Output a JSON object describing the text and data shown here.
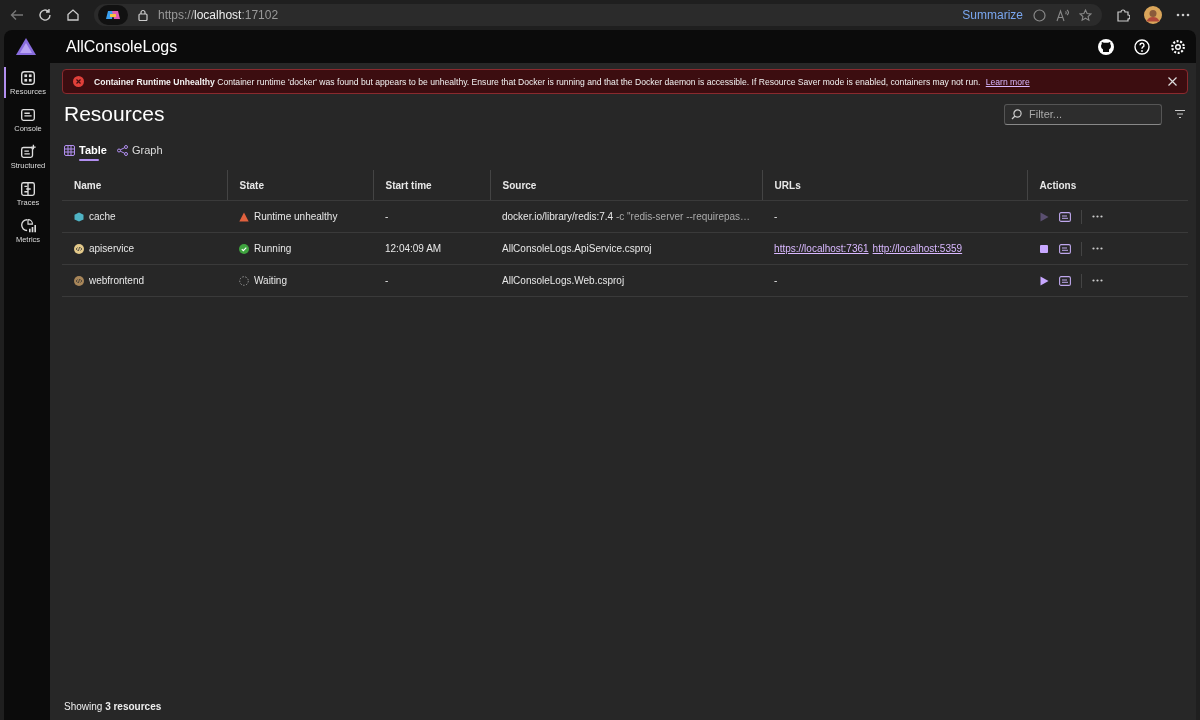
{
  "browser": {
    "url_scheme": "https://",
    "url_host": "localhost",
    "url_port": ":17102",
    "summarize": "Summarize"
  },
  "header": {
    "title": "AllConsoleLogs"
  },
  "sidebar": {
    "items": [
      {
        "label": "Resources",
        "kind": "resources",
        "selected": true
      },
      {
        "label": "Console",
        "kind": "console",
        "selected": false
      },
      {
        "label": "Structured",
        "kind": "structured",
        "selected": false
      },
      {
        "label": "Traces",
        "kind": "traces",
        "selected": false
      },
      {
        "label": "Metrics",
        "kind": "metrics",
        "selected": false
      }
    ]
  },
  "alert": {
    "title": "Container Runtime Unhealthy",
    "message": "Container runtime 'docker' was found but appears to be unhealthy. Ensure that Docker is running and that the Docker daemon is accessible. If Resource Saver mode is enabled, containers may not run.",
    "link": "Learn more"
  },
  "page_title": "Resources",
  "filter": {
    "placeholder": "Filter..."
  },
  "view_tabs": [
    {
      "label": "Table",
      "kind": "table",
      "selected": true
    },
    {
      "label": "Graph",
      "kind": "graph",
      "selected": false
    }
  ],
  "table": {
    "columns": [
      "Name",
      "State",
      "Start time",
      "Source",
      "URLs",
      "Actions"
    ],
    "rows": [
      {
        "name": "cache",
        "kind": "container",
        "color": "#4fb3c4",
        "state": {
          "text": "Runtime unhealthy",
          "kind": "warning"
        },
        "start_time": "-",
        "source": "docker.io/library/redis:7.4",
        "source_args": "-c \"redis-server --requirepas…",
        "urls": [],
        "urls_empty": "-",
        "action": {
          "kind": "start",
          "disabled": true
        }
      },
      {
        "name": "apiservice",
        "kind": "project",
        "color": "#e3c98a",
        "state": {
          "text": "Running",
          "kind": "running"
        },
        "start_time": "12:04:09 AM",
        "source": "AllConsoleLogs.ApiService.csproj",
        "urls": [
          "https://localhost:7361",
          "http://localhost:5359"
        ],
        "action": {
          "kind": "stop",
          "disabled": false
        }
      },
      {
        "name": "webfrontend",
        "kind": "project",
        "color": "#a88659",
        "state": {
          "text": "Waiting",
          "kind": "waiting"
        },
        "start_time": "-",
        "source": "AllConsoleLogs.Web.csproj",
        "urls": [],
        "urls_empty": "-",
        "action": {
          "kind": "start",
          "disabled": false
        }
      }
    ]
  },
  "footer": "Showing **3 resources**"
}
